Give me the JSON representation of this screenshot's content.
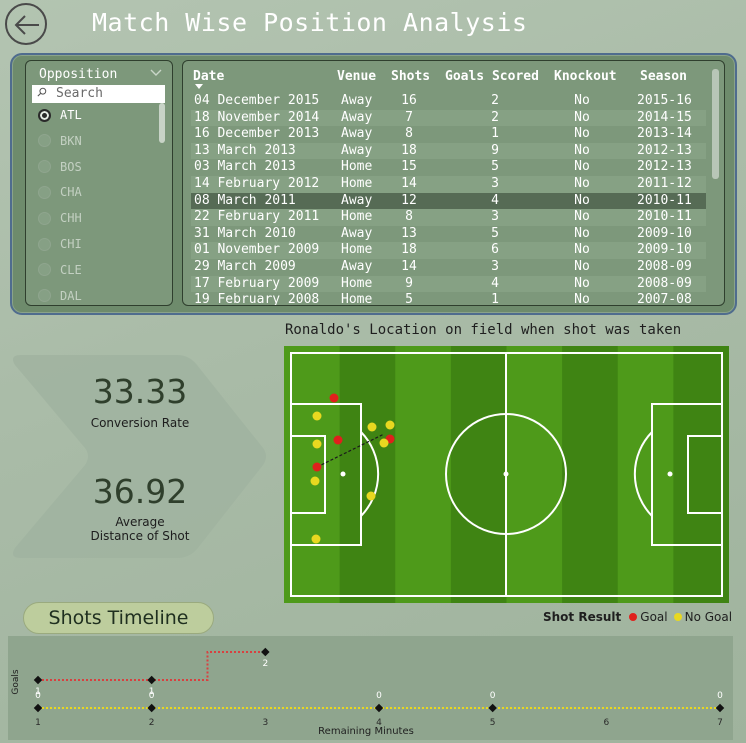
{
  "header": {
    "title": "Match Wise Position Analysis",
    "back_icon": "arrow-left-icon"
  },
  "slicer": {
    "title": "Opposition",
    "search_placeholder": "Search",
    "options": [
      "ATL",
      "BKN",
      "BOS",
      "CHA",
      "CHH",
      "CHI",
      "CLE",
      "DAL"
    ],
    "selected": "ATL"
  },
  "table": {
    "columns": [
      "Date",
      "Venue",
      "Shots",
      "Goals Scored",
      "Knockout",
      "Season"
    ],
    "selected_row": 6,
    "rows": [
      [
        "04 December 2015",
        "Away",
        "16",
        "2",
        "No",
        "2015-16"
      ],
      [
        "18 November 2014",
        "Away",
        "7",
        "2",
        "No",
        "2014-15"
      ],
      [
        "16 December 2013",
        "Away",
        "8",
        "1",
        "No",
        "2013-14"
      ],
      [
        "13 March 2013",
        "Away",
        "18",
        "9",
        "No",
        "2012-13"
      ],
      [
        "03 March 2013",
        "Home",
        "15",
        "5",
        "No",
        "2012-13"
      ],
      [
        "14 February 2012",
        "Home",
        "14",
        "3",
        "No",
        "2011-12"
      ],
      [
        "08 March 2011",
        "Away",
        "12",
        "4",
        "No",
        "2010-11"
      ],
      [
        "22 February 2011",
        "Home",
        "8",
        "3",
        "No",
        "2010-11"
      ],
      [
        "31 March 2010",
        "Away",
        "13",
        "5",
        "No",
        "2009-10"
      ],
      [
        "01 November 2009",
        "Home",
        "18",
        "6",
        "No",
        "2009-10"
      ],
      [
        "29 March 2009",
        "Away",
        "14",
        "3",
        "No",
        "2008-09"
      ],
      [
        "17 February 2009",
        "Home",
        "9",
        "4",
        "No",
        "2008-09"
      ],
      [
        "19 February 2008",
        "Home",
        "5",
        "1",
        "No",
        "2007-08"
      ]
    ]
  },
  "kpi": {
    "conversion_rate": "33.33",
    "conversion_label": "Conversion Rate",
    "avg_distance": "36.92",
    "avg_distance_label_1": "Average",
    "avg_distance_label_2": "Distance of Shot"
  },
  "field": {
    "title": "Ronaldo's Location on field when shot was taken",
    "colors": {
      "goal": "#e0201c",
      "no_goal": "#e8d820",
      "pitch_light": "#4e9a1a",
      "pitch_dark": "#3f8413"
    }
  },
  "legend": {
    "title": "Shot Result",
    "goal": "Goal",
    "no_goal": "No Goal"
  },
  "timeline": {
    "button": "Shots Timeline",
    "xlabel": "Remaining Minutes",
    "ylabel": "Goals",
    "x_ticks": [
      "1",
      "2",
      "3",
      "4",
      "5",
      "6",
      "7"
    ]
  },
  "chart_data": {
    "type": "line",
    "title": "Shots Timeline",
    "xlabel": "Remaining Minutes",
    "ylabel": "Goals",
    "xlim": [
      1,
      7
    ],
    "x_ticks": [
      1,
      2,
      3,
      4,
      5,
      6,
      7
    ],
    "series": [
      {
        "name": "Goal",
        "color": "#d84040",
        "points": [
          [
            1,
            1
          ],
          [
            2,
            1
          ],
          [
            3,
            2
          ]
        ]
      },
      {
        "name": "No Goal",
        "color": "#e8d820",
        "points": [
          [
            1,
            0
          ],
          [
            2,
            0
          ],
          [
            4,
            0
          ],
          [
            5,
            0
          ],
          [
            7,
            0
          ]
        ]
      }
    ]
  }
}
